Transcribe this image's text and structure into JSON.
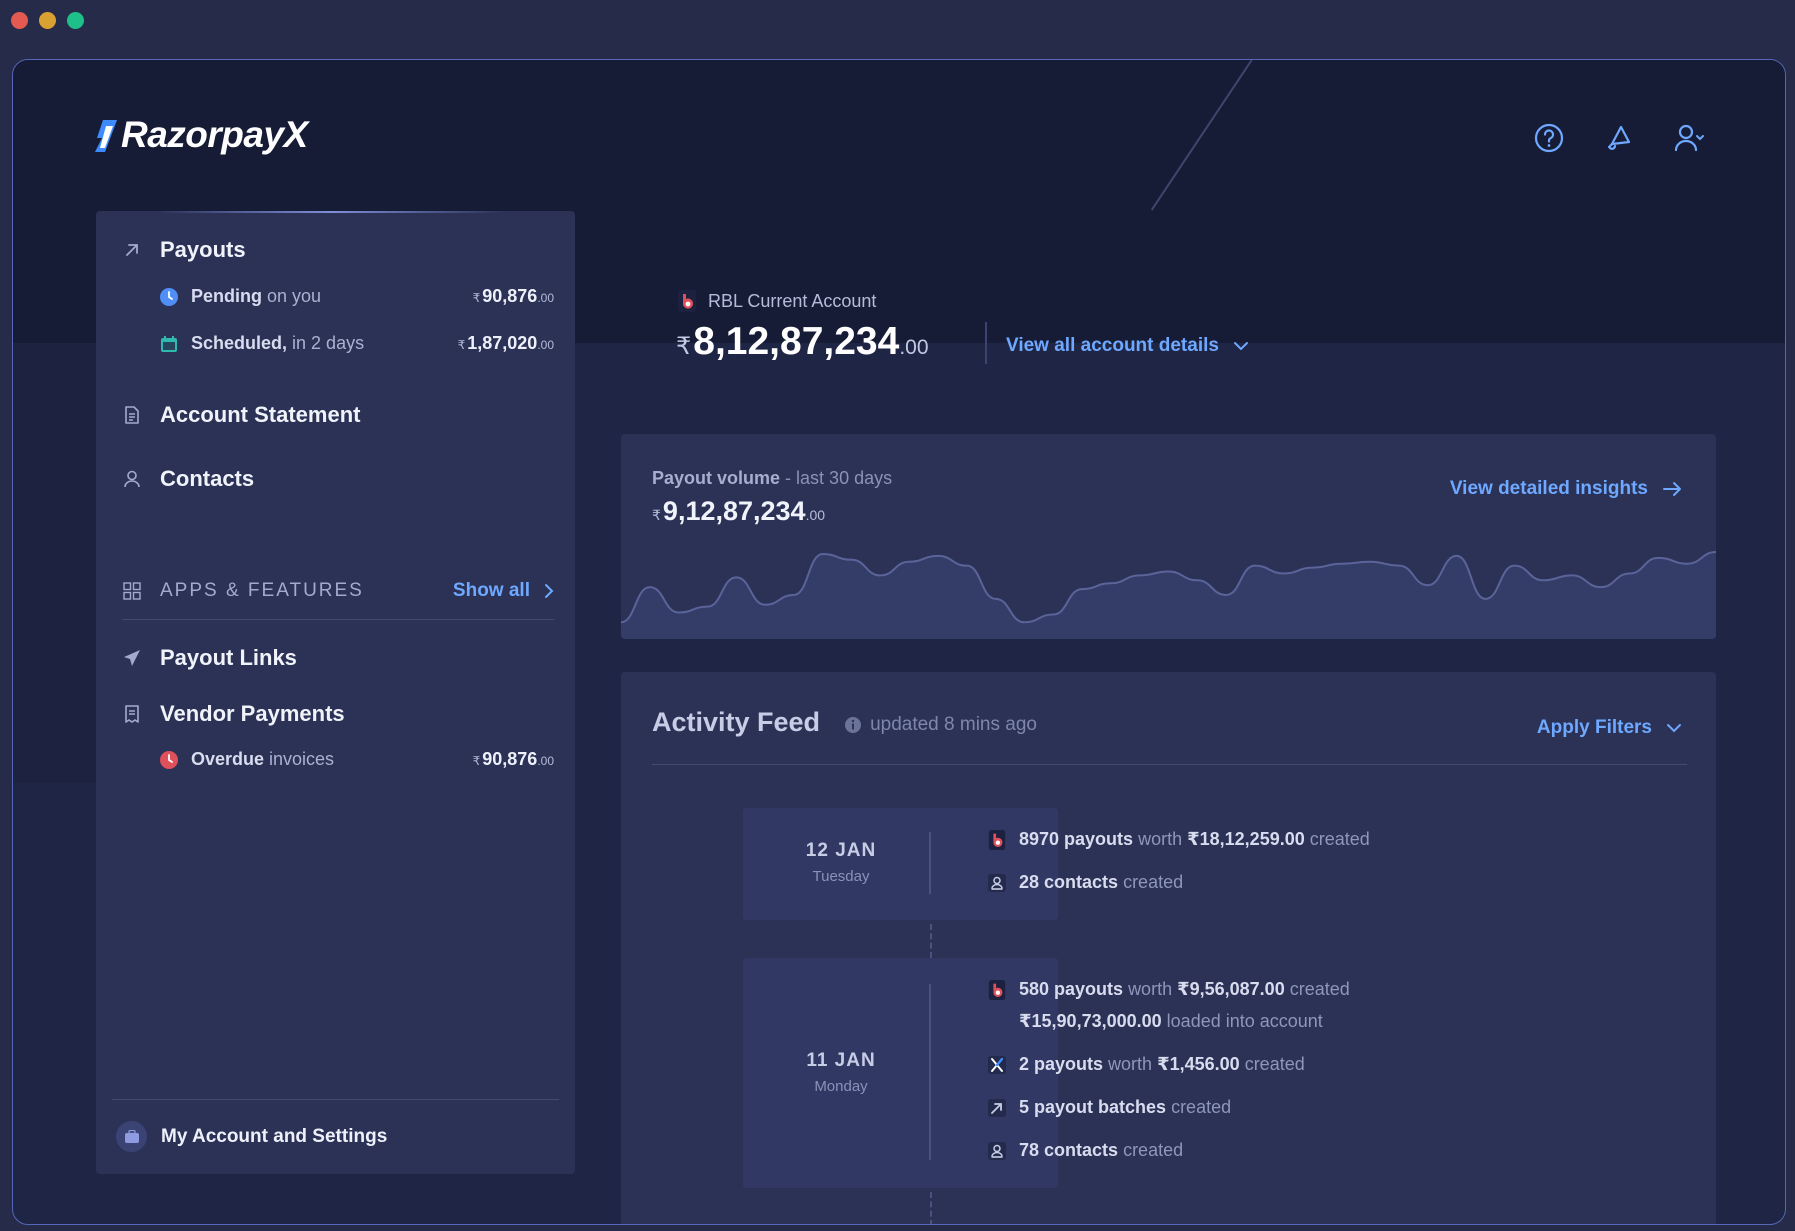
{
  "brand": {
    "name": "RazorpayX"
  },
  "header": {
    "icons": [
      "help-icon",
      "notification-icon",
      "user-menu-icon"
    ]
  },
  "sidebar": {
    "payouts": {
      "label": "Payouts",
      "pending": {
        "label": "Pending",
        "suffix": "on you",
        "currency": "₹",
        "amount": "90,876",
        "decimals": ".00"
      },
      "scheduled": {
        "label": "Scheduled,",
        "suffix": "in 2 days",
        "currency": "₹",
        "amount": "1,87,020",
        "decimals": ".00"
      }
    },
    "account_statement": "Account Statement",
    "contacts": "Contacts",
    "apps_features": {
      "label": "APPS & FEATURES",
      "show_all": "Show all"
    },
    "payout_links": "Payout Links",
    "vendor_payments": {
      "label": "Vendor Payments",
      "overdue": {
        "label": "Overdue",
        "suffix": "invoices",
        "currency": "₹",
        "amount": "90,876",
        "decimals": ".00"
      }
    },
    "settings": "My Account and Settings"
  },
  "account": {
    "name": "RBL Current Account",
    "currency": "₹",
    "balance": "8,12,87,234",
    "decimals": ".00",
    "view_details": "View all account details"
  },
  "payout_volume": {
    "title": "Payout volume",
    "period": "- last 30 days",
    "currency": "₹",
    "total": "9,12,87,234",
    "decimals": ".00",
    "insights_link": "View detailed insights"
  },
  "chart_data": {
    "type": "area",
    "title": "Payout volume - last 30 days",
    "xlabel": "",
    "ylabel": "",
    "grid": false,
    "legend": "none",
    "values": [
      12,
      48,
      22,
      28,
      58,
      30,
      40,
      82,
      76,
      60,
      74,
      80,
      70,
      36,
      12,
      20,
      46,
      52,
      60,
      64,
      55,
      40,
      70,
      62,
      68,
      72,
      74,
      70,
      50,
      80,
      36,
      70,
      55,
      60,
      48,
      62,
      78,
      72,
      84
    ]
  },
  "activity": {
    "title": "Activity Feed",
    "updated": "updated 8 mins ago",
    "filters": "Apply Filters",
    "days": [
      {
        "date": "12 JAN",
        "weekday": "Tuesday",
        "events": [
          {
            "icon": "razorpay-icon",
            "bold": "8970 payouts",
            "mid": "worth",
            "bold2": "₹18,12,259.00",
            "tail": "created"
          },
          {
            "icon": "contact-icon",
            "bold": "28 contacts",
            "tail": "created"
          }
        ]
      },
      {
        "date": "11 JAN",
        "weekday": "Monday",
        "events": [
          {
            "icon": "razorpay-icon",
            "bold": "580 payouts",
            "mid": "worth",
            "bold2": "₹9,56,087.00",
            "tail": "created"
          },
          {
            "bold": "₹15,90,73,000.00",
            "tail": "loaded into account"
          },
          {
            "icon": "razorpayx-icon",
            "bold": "2 payouts",
            "mid": "worth",
            "bold2": "₹1,456.00",
            "tail": "created"
          },
          {
            "icon": "batch-icon",
            "bold": "5 payout batches",
            "tail": "created"
          },
          {
            "icon": "contact-icon",
            "bold": "78 contacts",
            "tail": "created"
          }
        ]
      }
    ]
  },
  "colors": {
    "accent": "#6ea8ff",
    "background": "#1f2544",
    "card": "#2b3256",
    "danger": "#e0505a",
    "calendar": "#2fb9b0"
  }
}
